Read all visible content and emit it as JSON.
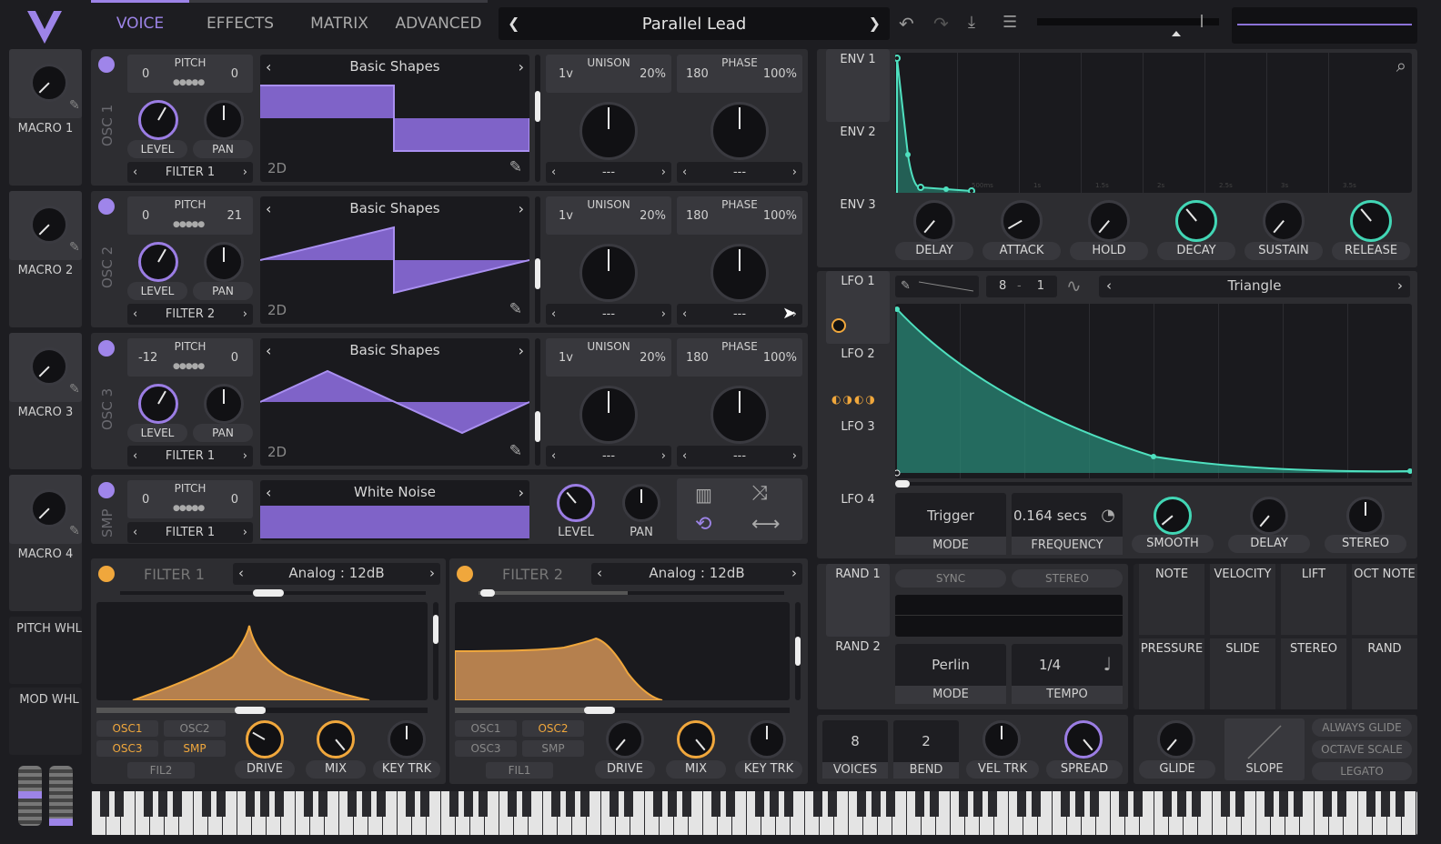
{
  "nav": {
    "tabs": [
      "VOICE",
      "EFFECTS",
      "MATRIX",
      "ADVANCED"
    ],
    "active": "VOICE",
    "preset": "Parallel Lead"
  },
  "macros": [
    {
      "label": "MACRO 1"
    },
    {
      "label": "MACRO 2"
    },
    {
      "label": "MACRO 3"
    },
    {
      "label": "MACRO 4"
    }
  ],
  "wheels": {
    "pitch": "PITCH WHL",
    "mod": "MOD WHL"
  },
  "osc": [
    {
      "name": "OSC 1",
      "pitch_l": "0",
      "pitch_r": "0",
      "pitch_label": "PITCH",
      "wave": "Basic Shapes",
      "dim": "2D",
      "filter": "FILTER 1",
      "level": "LEVEL",
      "pan": "PAN",
      "unison_l": "1v",
      "unison": "UNISON",
      "unison_r": "20%",
      "phase_l": "180",
      "phase": "PHASE",
      "phase_r": "100%",
      "dash1": "---",
      "dash2": "---"
    },
    {
      "name": "OSC 2",
      "pitch_l": "0",
      "pitch_r": "21",
      "pitch_label": "PITCH",
      "wave": "Basic Shapes",
      "dim": "2D",
      "filter": "FILTER 2",
      "level": "LEVEL",
      "pan": "PAN",
      "unison_l": "1v",
      "unison": "UNISON",
      "unison_r": "20%",
      "phase_l": "180",
      "phase": "PHASE",
      "phase_r": "100%",
      "dash1": "---",
      "dash2": "---"
    },
    {
      "name": "OSC 3",
      "pitch_l": "-12",
      "pitch_r": "0",
      "pitch_label": "PITCH",
      "wave": "Basic Shapes",
      "dim": "2D",
      "filter": "FILTER 1",
      "level": "LEVEL",
      "pan": "PAN",
      "unison_l": "1v",
      "unison": "UNISON",
      "unison_r": "20%",
      "phase_l": "180",
      "phase": "PHASE",
      "phase_r": "100%",
      "dash1": "---",
      "dash2": "---"
    }
  ],
  "smp": {
    "name": "SMP",
    "pitch_l": "0",
    "pitch_r": "0",
    "pitch_label": "PITCH",
    "wave": "White Noise",
    "filter": "FILTER 1",
    "level": "LEVEL",
    "pan": "PAN"
  },
  "filters": [
    {
      "name": "FILTER 1",
      "type": "Analog  :  12dB",
      "src": [
        "OSC1",
        "OSC2",
        "OSC3",
        "SMP"
      ],
      "route": "FIL2",
      "knobs": [
        "DRIVE",
        "MIX",
        "KEY TRK"
      ]
    },
    {
      "name": "FILTER 2",
      "type": "Analog  :  12dB",
      "src": [
        "OSC1",
        "OSC2",
        "OSC3",
        "SMP"
      ],
      "route": "FIL1",
      "knobs": [
        "DRIVE",
        "MIX",
        "KEY TRK"
      ]
    }
  ],
  "env": {
    "tabs": [
      "ENV 1",
      "ENV 2",
      "ENV 3"
    ],
    "knobs": [
      "DELAY",
      "ATTACK",
      "HOLD",
      "DECAY",
      "SUSTAIN",
      "RELEASE"
    ],
    "time_marks": [
      "500ms",
      "1s",
      "1.5s",
      "2s",
      "2.5s",
      "3s",
      "3.5s"
    ]
  },
  "lfo": {
    "tabs": [
      "LFO 1",
      "LFO 2",
      "LFO 3",
      "LFO 4"
    ],
    "shape": "Triangle",
    "grid_l": "8",
    "grid_sep": "-",
    "grid_r": "1",
    "mode": "Trigger",
    "mode_label": "MODE",
    "freq": "0.164 secs",
    "freq_label": "FREQUENCY",
    "knobs": [
      "SMOOTH",
      "DELAY",
      "STEREO"
    ]
  },
  "rand": {
    "tabs": [
      "RAND 1",
      "RAND 2"
    ],
    "sync": "SYNC",
    "stereo": "STEREO",
    "mode": "Perlin",
    "mode_label": "MODE",
    "tempo": "1/4",
    "tempo_label": "TEMPO"
  },
  "mods": [
    "NOTE",
    "VELOCITY",
    "LIFT",
    "OCT NOTE",
    "PRESSURE",
    "SLIDE",
    "STEREO",
    "RAND"
  ],
  "voice": {
    "voices": "8",
    "voices_label": "VOICES",
    "bend": "2",
    "bend_label": "BEND",
    "veltrk": "VEL TRK",
    "spread": "SPREAD",
    "glide": "GLIDE",
    "slope": "SLOPE",
    "opts": [
      "ALWAYS GLIDE",
      "OCTAVE SCALE",
      "LEGATO"
    ]
  }
}
